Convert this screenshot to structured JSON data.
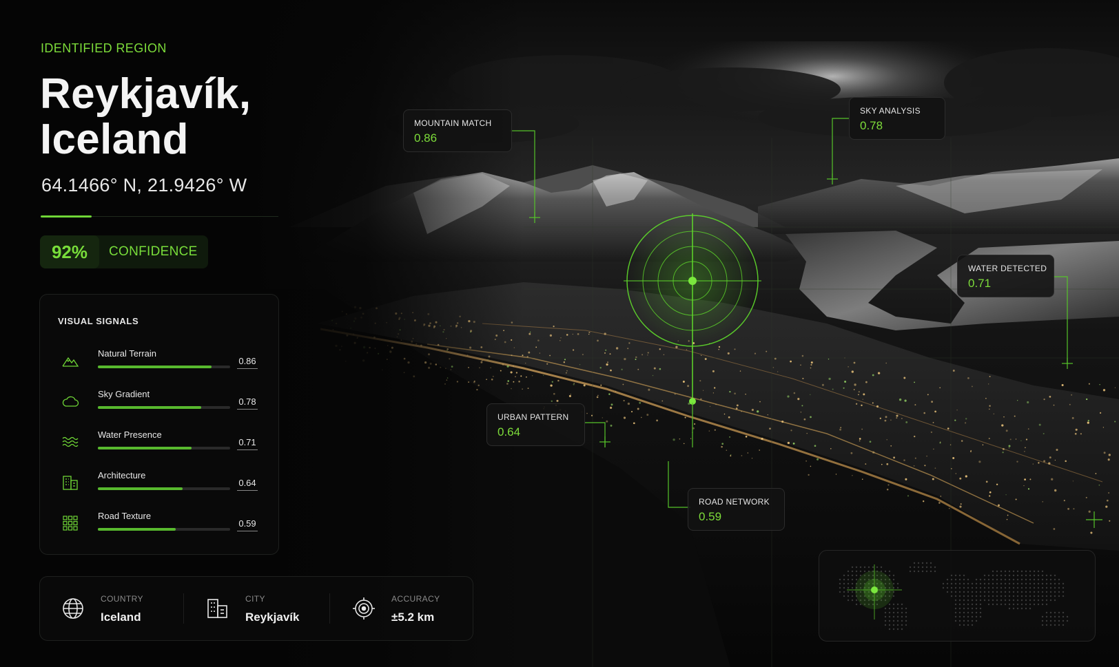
{
  "region": {
    "eyebrow": "IDENTIFIED REGION",
    "title_line1": "Reykjavík,",
    "title_line2": "Iceland",
    "coordinates": "64.1466° N, 21.9426° W"
  },
  "confidence": {
    "value": "92%",
    "label": "CONFIDENCE",
    "level": 0.92
  },
  "signals": {
    "title": "VISUAL SIGNALS",
    "items": [
      {
        "icon": "mountain-icon",
        "label": "Natural Terrain",
        "value": "0.86",
        "level": 0.86
      },
      {
        "icon": "cloud-icon",
        "label": "Sky Gradient",
        "value": "0.78",
        "level": 0.78
      },
      {
        "icon": "waves-icon",
        "label": "Water Presence",
        "value": "0.71",
        "level": 0.71
      },
      {
        "icon": "building-icon",
        "label": "Architecture",
        "value": "0.64",
        "level": 0.64
      },
      {
        "icon": "grid-icon",
        "label": "Road Texture",
        "value": "0.59",
        "level": 0.59
      }
    ]
  },
  "info": {
    "country": {
      "icon": "globe-icon",
      "label": "COUNTRY",
      "value": "Iceland"
    },
    "city": {
      "icon": "city-icon",
      "label": "CITY",
      "value": "Reykjavík"
    },
    "accuracy": {
      "icon": "target-icon",
      "label": "ACCURACY",
      "value": "±5.2 km"
    }
  },
  "tags": {
    "mountain": {
      "label": "MOUNTAIN MATCH",
      "value": "0.86"
    },
    "sky": {
      "label": "SKY ANALYSIS",
      "value": "0.78"
    },
    "water": {
      "label": "WATER DETECTED",
      "value": "0.71"
    },
    "urban": {
      "label": "URBAN PATTERN",
      "value": "0.64"
    },
    "road": {
      "label": "ROAD NETWORK",
      "value": "0.59"
    }
  },
  "colors": {
    "accent": "#7ddc3a",
    "bar_fill": "#58b92e",
    "background": "#050505"
  }
}
